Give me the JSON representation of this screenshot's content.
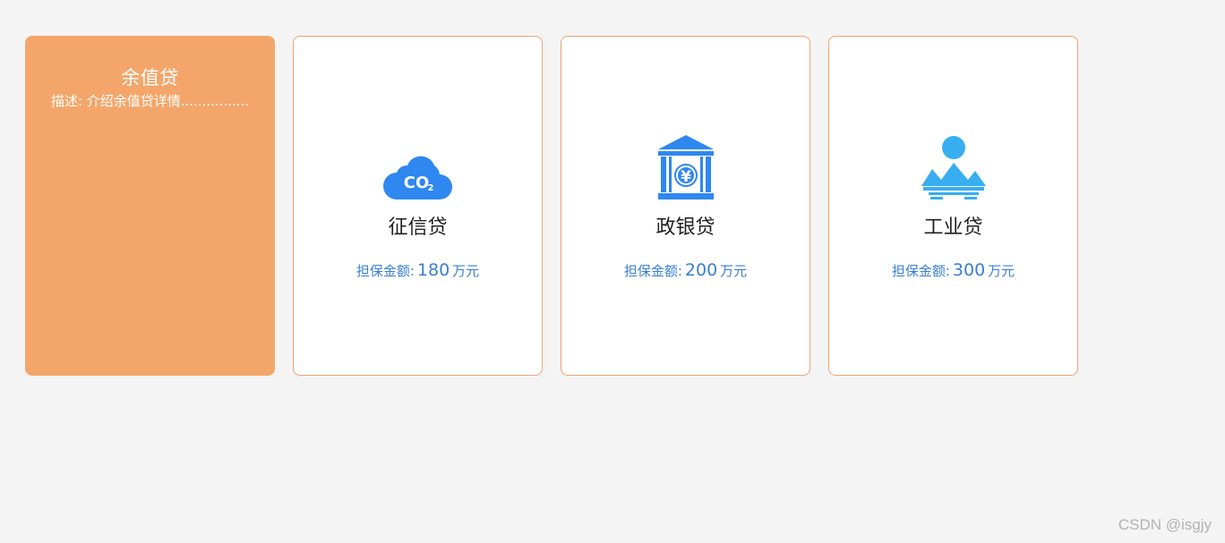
{
  "featured": {
    "title": "余值贷",
    "description": "描述: 介绍余值贷详情................"
  },
  "products": [
    {
      "title": "征信贷",
      "amount_label": "担保金额:",
      "amount": "180",
      "unit": "万元",
      "icon": "co2-cloud-icon",
      "icon_text": "CO",
      "icon_sub": "2"
    },
    {
      "title": "政银贷",
      "amount_label": "担保金额:",
      "amount": "200",
      "unit": "万元",
      "icon": "bank-yuan-icon",
      "icon_text": "¥"
    },
    {
      "title": "工业贷",
      "amount_label": "担保金额:",
      "amount": "300",
      "unit": "万元",
      "icon": "landscape-sun-icon"
    }
  ],
  "colors": {
    "background": "#f4f4f5",
    "featured_card": "#f4a66a",
    "card_border": "#eea372",
    "amount_text": "#3a7fd5",
    "icon_blue": "#2f87f0",
    "icon_light_blue": "#38aef0"
  },
  "watermark": "CSDN @isgjy"
}
